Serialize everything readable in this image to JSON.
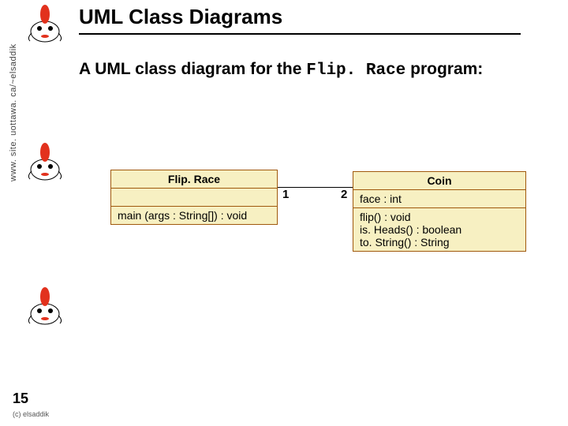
{
  "header": {
    "title": "UML Class Diagrams"
  },
  "sidebar": {
    "url_text": "www. site. uottawa. ca/~elsaddik"
  },
  "subtitle": {
    "prefix": "A UML class diagram for the ",
    "code": "Flip. Race",
    "suffix": " program:"
  },
  "uml": {
    "flip_race": {
      "name": "Flip. Race",
      "methods": [
        "main (args : String[]) : void"
      ]
    },
    "coin": {
      "name": "Coin",
      "attributes": [
        "face : int"
      ],
      "methods": [
        "flip() : void",
        "is. Heads() : boolean",
        "to. String() : String"
      ]
    },
    "assoc": {
      "left_mult": "1",
      "right_mult": "2"
    }
  },
  "footer": {
    "page": "15",
    "copyright": "(c) elsaddik"
  }
}
